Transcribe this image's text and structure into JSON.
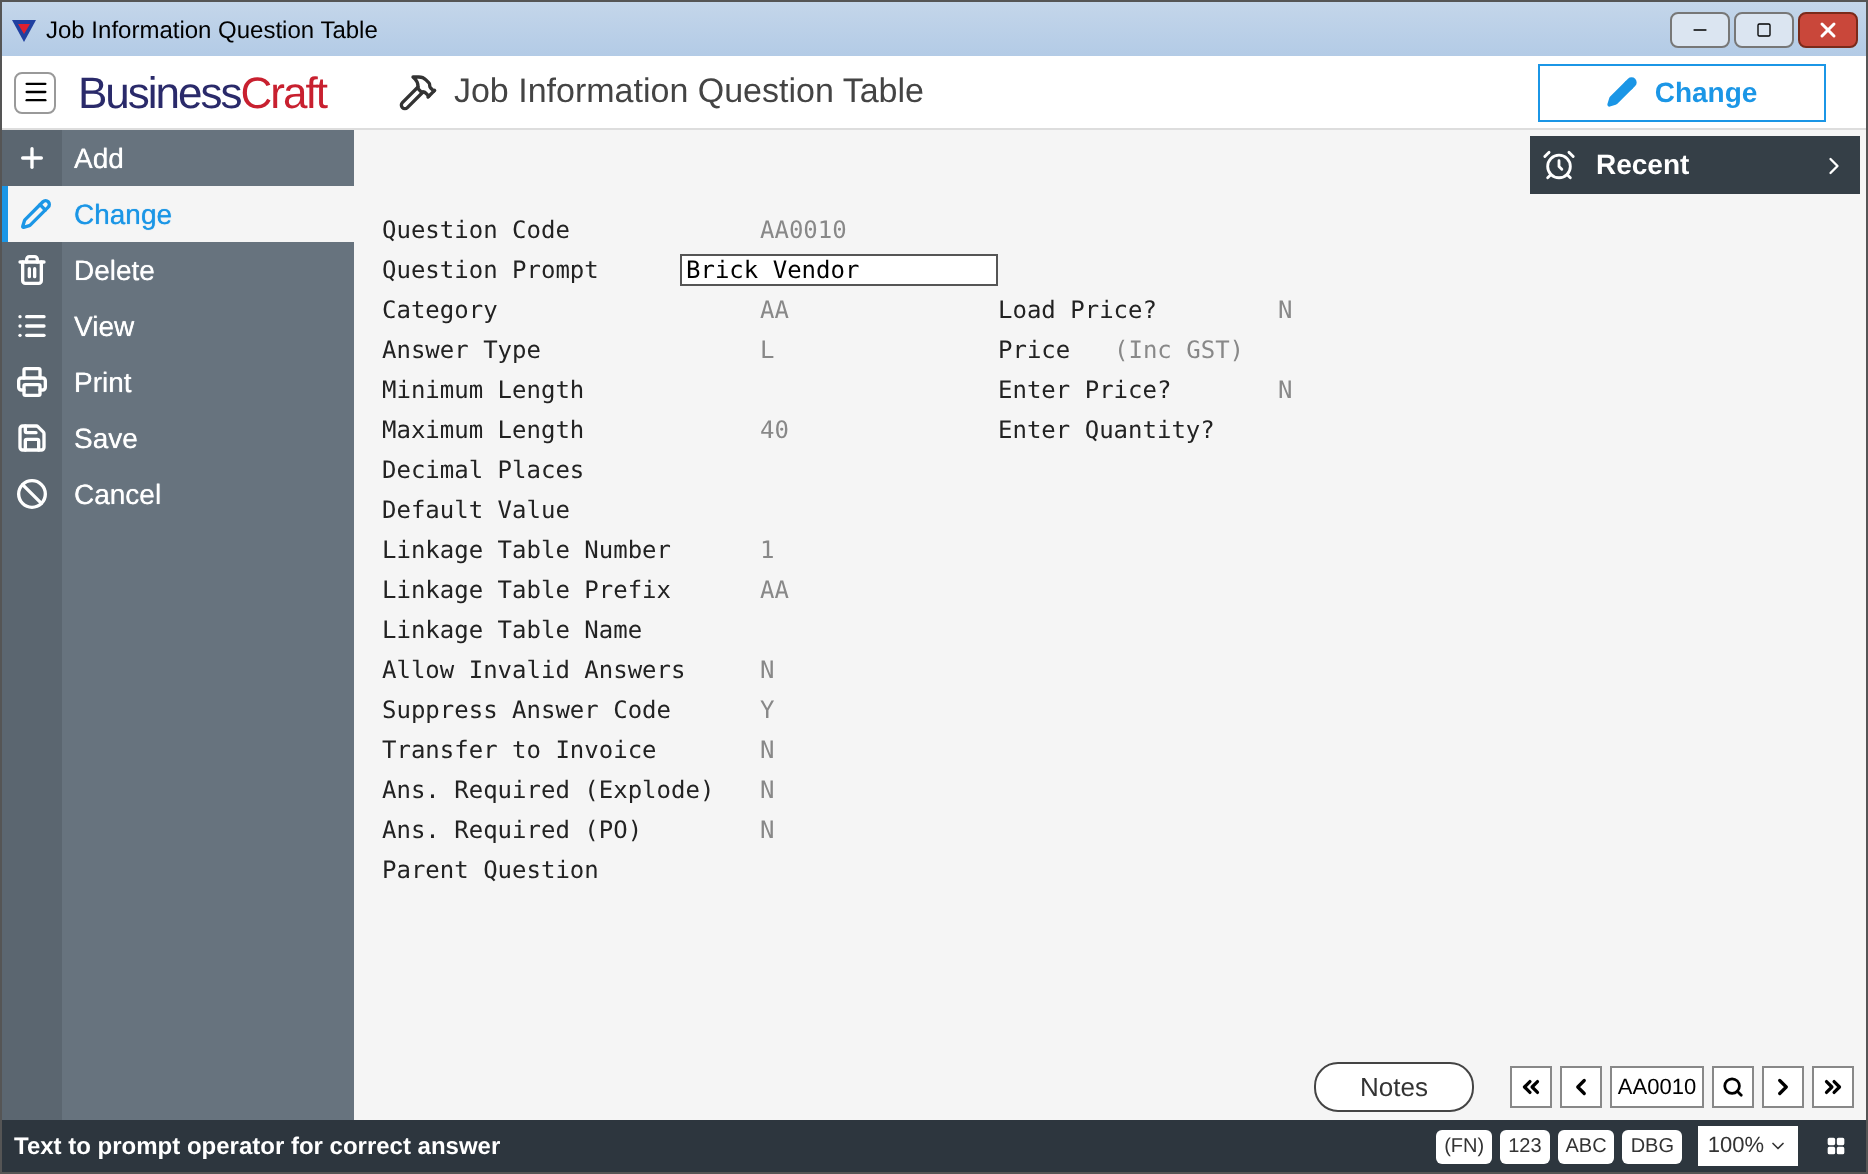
{
  "window": {
    "title": "Job Information Question Table"
  },
  "header": {
    "logo_dark": "Business",
    "logo_red": "Craft",
    "title": "Job Information Question Table",
    "action": "Change"
  },
  "sidebar": {
    "items": [
      {
        "label": "Add",
        "kind": "add",
        "selected": false
      },
      {
        "label": "Change",
        "kind": "change",
        "selected": true
      },
      {
        "label": "Delete",
        "kind": "delete",
        "selected": false
      },
      {
        "label": "View",
        "kind": "view",
        "selected": false
      },
      {
        "label": "Print",
        "kind": "print",
        "selected": false
      },
      {
        "label": "Save",
        "kind": "save",
        "selected": false
      },
      {
        "label": "Cancel",
        "kind": "cancel",
        "selected": false
      }
    ]
  },
  "recent": {
    "label": "Recent"
  },
  "form_left": [
    {
      "label": "Question Code",
      "value": "AA0010",
      "kind": "text"
    },
    {
      "label": "Question Prompt",
      "value": "Brick Vendor",
      "kind": "input"
    },
    {
      "label": "Category",
      "value": "AA",
      "kind": "text"
    },
    {
      "label": "Answer Type",
      "value": "L",
      "kind": "text"
    },
    {
      "label": "Minimum Length"
    },
    {
      "label": "Maximum Length",
      "value": "40",
      "kind": "text"
    },
    {
      "label": "Decimal Places"
    },
    {
      "label": "Default Value"
    },
    {
      "label": "Linkage Table Number",
      "value": "1",
      "kind": "text"
    },
    {
      "label": "Linkage Table Prefix",
      "value": "AA",
      "kind": "text"
    },
    {
      "label": "Linkage Table Name"
    },
    {
      "label": "Allow Invalid Answers",
      "value": "N",
      "kind": "text"
    },
    {
      "label": "Suppress Answer Code",
      "value": "Y",
      "kind": "text"
    },
    {
      "label": "Transfer to Invoice",
      "value": "N",
      "kind": "text"
    },
    {
      "label": "Ans. Required (Explode)",
      "value": "N",
      "kind": "text"
    },
    {
      "label": "Ans. Required (PO)",
      "value": "N",
      "kind": "text"
    },
    {
      "label": "Parent Question"
    }
  ],
  "form_right": [
    {
      "label": "Load Price?",
      "value": "N",
      "kind": "text"
    },
    {
      "label": "Price",
      "value": "(Inc GST)",
      "kind": "note"
    },
    {
      "label": "Enter Price?",
      "value": "N",
      "kind": "text"
    },
    {
      "label": "Enter Quantity?"
    }
  ],
  "notes_button": "Notes",
  "navigator": {
    "value": "AA0010"
  },
  "status_bar": {
    "message": "Text to prompt operator for correct answer",
    "chips": [
      "(FN)",
      "123",
      "ABC",
      "DBG"
    ],
    "zoom": "100%"
  }
}
